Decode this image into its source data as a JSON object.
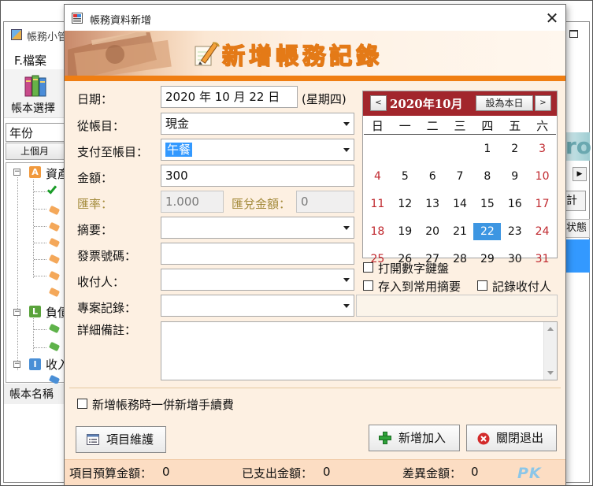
{
  "background_window": {
    "title": "帳務小管",
    "menu_file": "F.檔案",
    "book_select_label": "帳本選擇",
    "year_label": "年份",
    "prev_month_button": "上個月",
    "tree": {
      "assets": {
        "badge": "A",
        "label": "資產",
        "color": "#f19a3e"
      },
      "liabilities": {
        "badge": "L",
        "label": "負債",
        "color": "#5aa33c"
      },
      "income": {
        "badge": "I",
        "label": "收入",
        "color": "#4a8fd6"
      }
    },
    "book_name_label": "帳本名稱",
    "teal_text": "ro",
    "grid_button": "計",
    "grid_header": "状態"
  },
  "dialog": {
    "title": "帳務資料新增",
    "heading": "新增帳務記錄",
    "fields": {
      "date": {
        "label": "日期：",
        "value": "2020 年 10 月 22 日",
        "weekday": "(星期四)"
      },
      "from_account": {
        "label": "從帳目：",
        "value": "現金"
      },
      "to_account": {
        "label": "支付至帳目：",
        "value": "午餐"
      },
      "amount": {
        "label": "金額：",
        "value": "300"
      },
      "exchange_rate": {
        "label": "匯率：",
        "value": "1.000"
      },
      "exchange_amount": {
        "label": "匯兌金額：",
        "value": "0"
      },
      "summary": {
        "label": "摘要：",
        "value": ""
      },
      "invoice_no": {
        "label": "發票號碼：",
        "value": ""
      },
      "payee": {
        "label": "收付人：",
        "value": ""
      },
      "project": {
        "label": "專案記錄：",
        "value": ""
      },
      "detail_note": {
        "label": "詳細備註：",
        "value": ""
      }
    },
    "calendar": {
      "title": "2020年10月",
      "prev": "<",
      "next": ">",
      "today_button": "設為本日",
      "weekdays": [
        "日",
        "一",
        "二",
        "三",
        "四",
        "五",
        "六"
      ],
      "weeks": [
        [
          "",
          "",
          "",
          "",
          "1",
          "2",
          "3"
        ],
        [
          "4",
          "5",
          "6",
          "7",
          "8",
          "9",
          "10"
        ],
        [
          "11",
          "12",
          "13",
          "14",
          "15",
          "16",
          "17"
        ],
        [
          "18",
          "19",
          "20",
          "21",
          "22",
          "23",
          "24"
        ],
        [
          "25",
          "26",
          "27",
          "28",
          "29",
          "30",
          "31"
        ]
      ],
      "selected_day": "22",
      "weekend_color": "#c0282e",
      "header_color": "#a2262c"
    },
    "options": {
      "numeric_keypad": "打開數字鍵盤",
      "save_common_summary": "存入到常用摘要",
      "record_payee": "記錄收付人",
      "add_fee": "新增帳務時一併新增手續費"
    },
    "buttons": {
      "items": "項目維護",
      "add": "新增加入",
      "close": "關閉退出"
    },
    "footer": {
      "budget_label": "項目預算金額：",
      "budget_value": "0",
      "spent_label": "已支出金額：",
      "spent_value": "0",
      "diff_label": "差異金額：",
      "diff_value": "0"
    },
    "accent_color": "#f07e12"
  },
  "watermark": {
    "text": "PK",
    "sub": "PK"
  }
}
